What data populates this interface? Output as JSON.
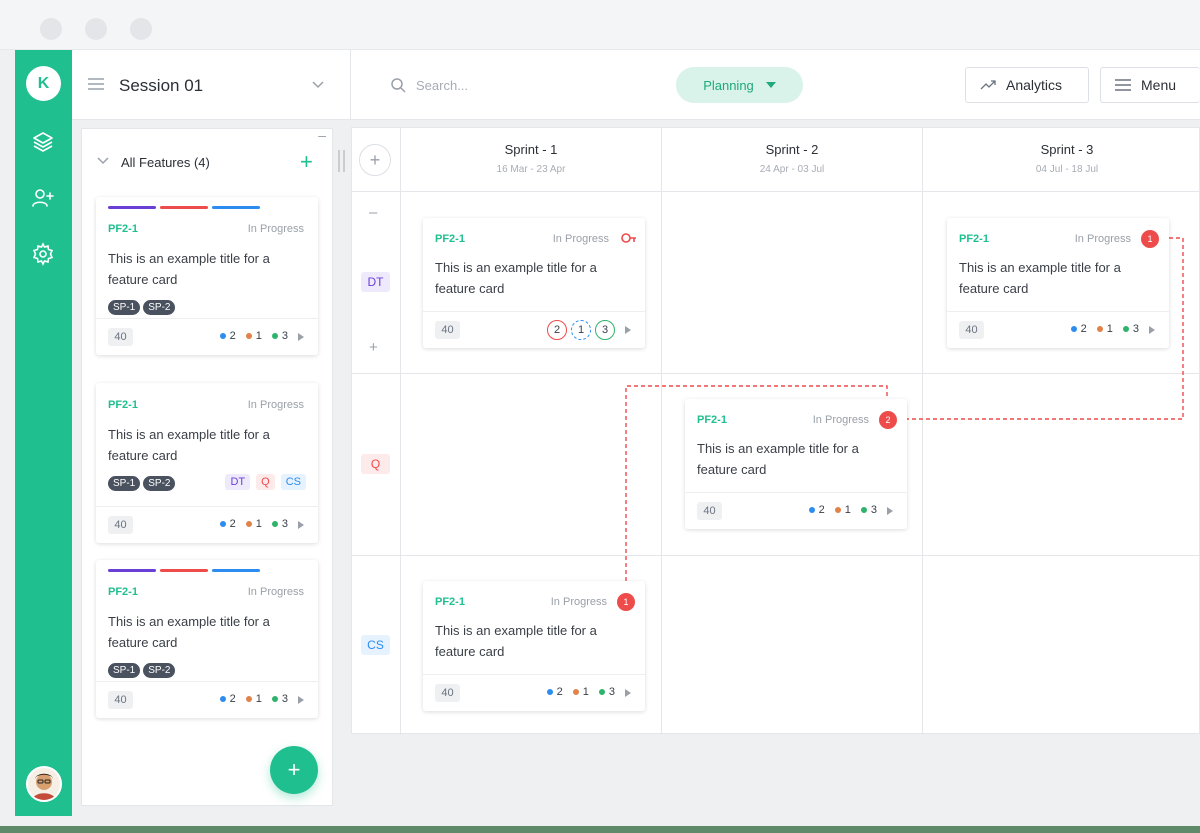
{
  "app": {
    "logo_letter": "K",
    "session_title": "Session 01",
    "search_placeholder": "Search...",
    "mode_label": "Planning",
    "analytics_label": "Analytics",
    "menu_label": "Menu",
    "accent_color": "#1fbf8f"
  },
  "sidebar_icons": [
    "layers-icon",
    "add-user-icon",
    "settings-icon"
  ],
  "features_panel": {
    "title": "All Features (4)",
    "cards": [
      {
        "code": "PF2-1",
        "status": "In Progress",
        "title": "This is an example title for a feature card",
        "tags": [
          "SP-1",
          "SP-2"
        ],
        "points": "40",
        "counts": [
          "2",
          "1",
          "3"
        ]
      },
      {
        "code": "PF2-1",
        "status": "In Progress",
        "title": "This is an example title for a feature card",
        "tags": [
          "SP-1",
          "SP-2"
        ],
        "teams": [
          "DT",
          "Q",
          "CS"
        ],
        "points": "40",
        "counts": [
          "2",
          "1",
          "3"
        ]
      },
      {
        "code": "PF2-1",
        "status": "In Progress",
        "title": "This is an example title for a feature card",
        "tags": [
          "SP-1",
          "SP-2"
        ],
        "points": "40",
        "counts": [
          "2",
          "1",
          "3"
        ]
      }
    ],
    "add_button": "+"
  },
  "board": {
    "sprints": [
      {
        "name": "Sprint - 1",
        "dates": "16 Mar - 23 Apr"
      },
      {
        "name": "Sprint - 2",
        "dates": "24 Apr - 03 Jul"
      },
      {
        "name": "Sprint - 3",
        "dates": "04 Jul - 18 Jul"
      }
    ],
    "rows": [
      "DT",
      "Q",
      "CS"
    ],
    "cards": [
      {
        "code": "PF2-1",
        "status": "In Progress",
        "title": "This is an example title for a feature card",
        "points": "40",
        "counts": [
          "2",
          "1",
          "3"
        ]
      },
      {
        "code": "PF2-1",
        "status": "In Progress",
        "title": "This is an example title for a feature card",
        "points": "40",
        "counts": [
          "2",
          "1",
          "3"
        ],
        "badge": "1"
      },
      {
        "code": "PF2-1",
        "status": "In Progress",
        "title": "This is an example title for a feature card",
        "points": "40",
        "counts": [
          "2",
          "1",
          "3"
        ],
        "badge": "2"
      },
      {
        "code": "PF2-1",
        "status": "In Progress",
        "title": "This is an example title for a feature card",
        "points": "40",
        "counts": [
          "2",
          "1",
          "3"
        ],
        "badge": "1"
      }
    ]
  }
}
